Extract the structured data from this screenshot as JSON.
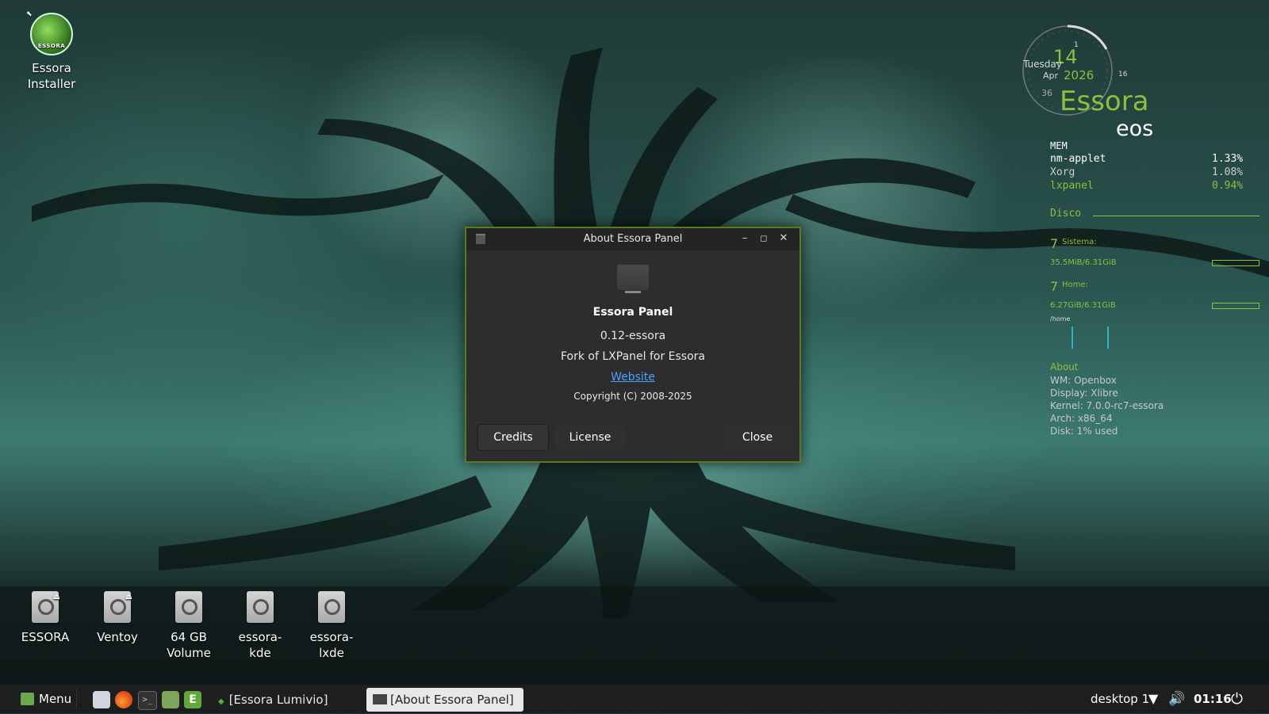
{
  "desktop": {
    "installer": {
      "label_line1": "Essora",
      "label_line2": "Installer",
      "logo_text": "ESSORA"
    },
    "drives": [
      {
        "line1": "ESSORA",
        "line2": "",
        "eject": true
      },
      {
        "line1": "Ventoy",
        "line2": "",
        "eject": true
      },
      {
        "line1": "64 GB",
        "line2": "Volume",
        "eject": false
      },
      {
        "line1": "essora-",
        "line2": "kde",
        "eject": false
      },
      {
        "line1": "essora-",
        "line2": "lxde",
        "eject": false
      }
    ]
  },
  "conky": {
    "day": "14",
    "weekday": "Tuesday",
    "month": "Apr",
    "year": "2026",
    "clock_hour": "1",
    "clock_min": "16",
    "clock_sec": "36",
    "distro": "Essora",
    "subtitle": "eos",
    "mem_title": "MEM",
    "procs": [
      {
        "name": "nm-applet",
        "value": "1.33%"
      },
      {
        "name": "Xorg",
        "value": "1.08%"
      },
      {
        "name": "lxpanel",
        "value": "0.94%"
      }
    ],
    "disk_title": "Disco",
    "sistema_count": "7",
    "sistema_label": "Sistema:",
    "sistema_usage": "35.5MiB/6.31GiB",
    "home_count": "7",
    "home_label": "Home:",
    "home_usage": "6.27GiB/6.31GiB",
    "home_path": "/home",
    "about_title": "About",
    "about_lines": [
      "WM: Openbox",
      "Display: Xlibre",
      "Kernel: 7.0.0-rc7-essora",
      "Arch: x86_64",
      "Disk: 1% used"
    ]
  },
  "dialog": {
    "title": "About Essora Panel",
    "app_name": "Essora Panel",
    "version": "0.12-essora",
    "comments": "Fork of LXPanel for Essora",
    "website": "Website",
    "copyright": "Copyright (C) 2008-2025",
    "buttons": {
      "credits": "Credits",
      "license": "License",
      "close": "Close"
    },
    "controls": {
      "minimize": "–",
      "maximize": "◻",
      "close": "✕"
    }
  },
  "taskbar": {
    "menu_label": "Menu",
    "tasks": [
      {
        "label": "[Essora Lumivio]",
        "active": false
      },
      {
        "label": "[About Essora Panel]",
        "active": true
      }
    ],
    "desktop_label": "desktop 1",
    "time": "01:16"
  },
  "colors": {
    "accent_green": "#8fbf3f",
    "dialog_border": "#5b7a1f",
    "link": "#4aa3ff"
  }
}
